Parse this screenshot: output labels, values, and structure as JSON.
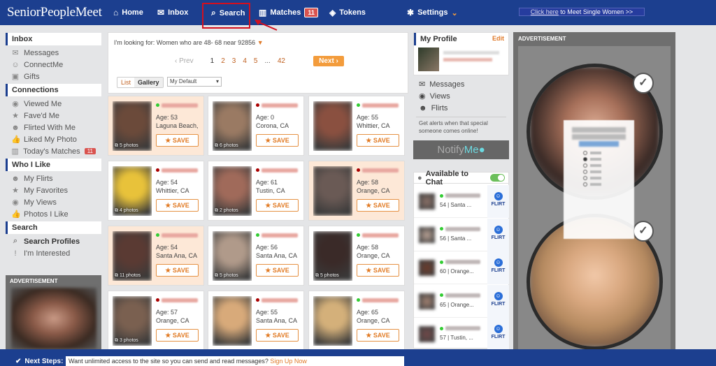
{
  "header": {
    "logo": "SeniorPeopleMeet",
    "nav": [
      {
        "label": "Home",
        "icon": "home-icon"
      },
      {
        "label": "Inbox",
        "icon": "envelope-icon"
      },
      {
        "label": "Search",
        "icon": "search-icon"
      },
      {
        "label": "Matches",
        "icon": "matches-icon",
        "badge": "11"
      },
      {
        "label": "Tokens",
        "icon": "shield-icon"
      },
      {
        "label": "Settings",
        "icon": "gear-icon"
      }
    ],
    "promo_link": "Click here",
    "promo_rest": " to Meet Single Women >>"
  },
  "sidebar": {
    "inbox_title": "Inbox",
    "inbox_items": [
      {
        "label": "Messages",
        "icon": "envelope-icon"
      },
      {
        "label": "ConnectMe",
        "icon": "person-icon"
      },
      {
        "label": "Gifts",
        "icon": "gift-icon"
      }
    ],
    "connections_title": "Connections",
    "connections_items": [
      {
        "label": "Viewed Me",
        "icon": "eye-icon"
      },
      {
        "label": "Fave'd Me",
        "icon": "star-icon"
      },
      {
        "label": "Flirted With Me",
        "icon": "smiley-icon"
      },
      {
        "label": "Liked My Photo",
        "icon": "thumbs-up-icon"
      },
      {
        "label": "Today's Matches",
        "icon": "matches-icon",
        "badge": "11"
      }
    ],
    "wholike_title": "Who I Like",
    "wholike_items": [
      {
        "label": "My Flirts",
        "icon": "smiley-icon"
      },
      {
        "label": "My Favorites",
        "icon": "star-icon"
      },
      {
        "label": "My Views",
        "icon": "eye-icon"
      },
      {
        "label": "Photos I Like",
        "icon": "thumbs-up-icon"
      }
    ],
    "search_title": "Search",
    "search_items": [
      {
        "label": "Search Profiles",
        "icon": "search-icon"
      },
      {
        "label": "I'm Interested",
        "icon": "exclamation-icon"
      }
    ],
    "advertisement": "ADVERTISEMENT"
  },
  "results": {
    "looking_for": "I'm looking for: Women who are 48- 68 near 92856",
    "prev": "Prev",
    "pages": [
      "1",
      "2",
      "3",
      "4",
      "5",
      "...",
      "42"
    ],
    "current_page": "1",
    "next": "Next",
    "view_list": "List",
    "view_gallery": "Gallery",
    "sort": "My Default",
    "save_label": "SAVE",
    "profiles": [
      {
        "age": "Age: 53",
        "location": "Laguna Beach, CA",
        "photos": "5 photos",
        "status": "#3c3",
        "highlight": true,
        "face": "#6b4a3a"
      },
      {
        "age": "Age: 0",
        "location": "Corona, CA",
        "photos": "6 photos",
        "status": "#a00",
        "highlight": false,
        "face": "#9a7a63"
      },
      {
        "age": "Age: 55",
        "location": "Whittier, CA",
        "photos": "",
        "status": "#3c3",
        "highlight": false,
        "face": "#8a5040"
      },
      {
        "age": "Age: 54",
        "location": "Whittier, CA",
        "photos": "4 photos",
        "status": "#a00",
        "highlight": false,
        "face": "#e8c23a"
      },
      {
        "age": "Age: 61",
        "location": "Tustin, CA",
        "photos": "2 photos",
        "status": "#a00",
        "highlight": false,
        "face": "#a06a5a"
      },
      {
        "age": "Age: 58",
        "location": "Orange, CA",
        "photos": "",
        "status": "#a00",
        "highlight": true,
        "face": "#6a5a55"
      },
      {
        "age": "Age: 54",
        "location": "Santa Ana, CA",
        "photos": "11 photos",
        "status": "#3c3",
        "highlight": true,
        "face": "#5a3a33"
      },
      {
        "age": "Age: 56",
        "location": "Santa Ana, CA",
        "photos": "5 photos",
        "status": "#3c3",
        "highlight": false,
        "face": "#b09a8a"
      },
      {
        "age": "Age: 58",
        "location": "Orange, CA",
        "photos": "5 photos",
        "status": "#3c3",
        "highlight": false,
        "face": "#3a2a28"
      },
      {
        "age": "Age: 57",
        "location": "Orange, CA",
        "photos": "3 photos",
        "status": "#a00",
        "highlight": false,
        "face": "#7a6050"
      },
      {
        "age": "Age: 55",
        "location": "Santa Ana, CA",
        "photos": "",
        "status": "#a00",
        "highlight": false,
        "face": "#d8aa7a"
      },
      {
        "age": "Age: 65",
        "location": "Orange, CA",
        "photos": "",
        "status": "#3c3",
        "highlight": false,
        "face": "#d4b07a"
      }
    ]
  },
  "profile": {
    "title": "My Profile",
    "edit": "Edit",
    "links": [
      {
        "label": "Messages",
        "icon": "envelope-icon"
      },
      {
        "label": "Views",
        "icon": "eye-icon"
      },
      {
        "label": "Flirts",
        "icon": "smiley-icon"
      }
    ],
    "alert_text": "Get alerts when that special someone comes online!",
    "notify_a": "Notify",
    "notify_b": "Me"
  },
  "chat": {
    "title": "Available to Chat",
    "flirt_label": "FLIRT",
    "rows": [
      {
        "desc": "54 | Santa ...",
        "face": "#8a7066"
      },
      {
        "desc": "56 | Santa ...",
        "face": "#b7a093"
      },
      {
        "desc": "60 | Orange...",
        "face": "#6a3a2a"
      },
      {
        "desc": "65 | Orange...",
        "face": "#a08070"
      },
      {
        "desc": "57 | Tustin, ...",
        "face": "#704848"
      }
    ]
  },
  "right_ad": {
    "title": "ADVERTISEMENT"
  },
  "footer": {
    "next_steps": "Next Steps:",
    "message": "Want unlimited access to the site so you can send and read messages?",
    "cta": "Sign Up Now"
  }
}
